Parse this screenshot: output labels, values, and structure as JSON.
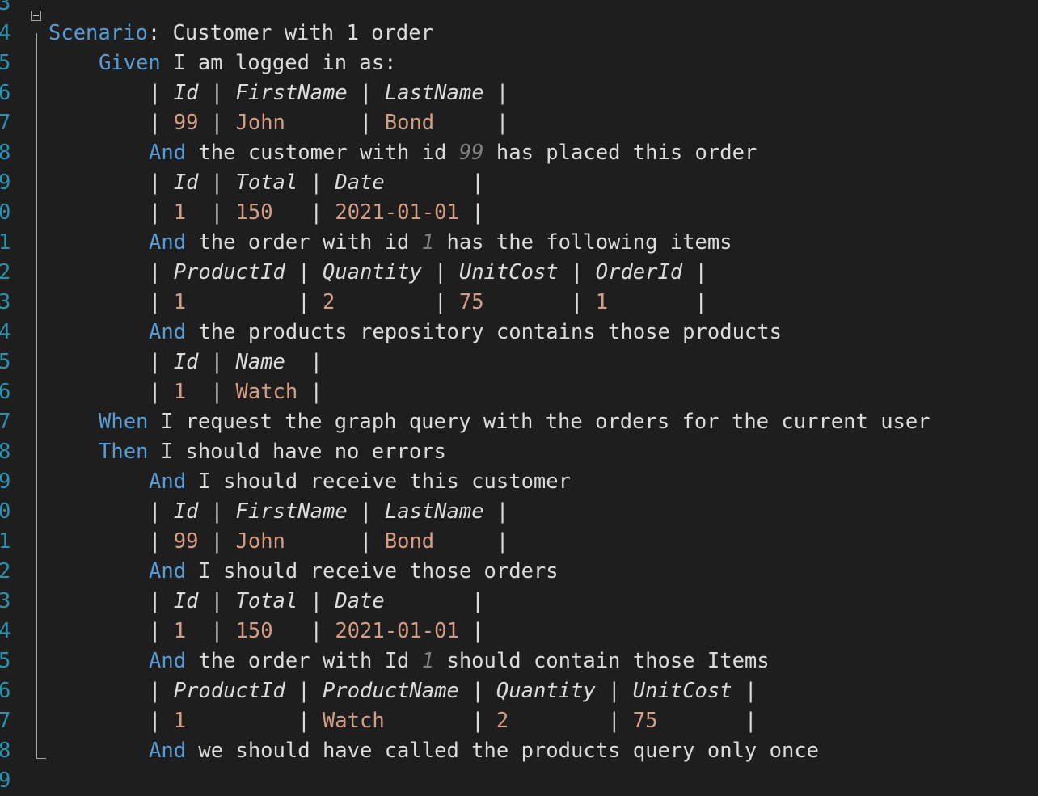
{
  "editor": {
    "lines": [
      {
        "num": "3",
        "segments": []
      },
      {
        "num": "4",
        "indent": 0,
        "segments": [
          {
            "cls": "kw",
            "t": "Scenario"
          },
          {
            "cls": "",
            "t": ": Customer with 1 order"
          }
        ]
      },
      {
        "num": "5",
        "indent": 1,
        "segments": [
          {
            "cls": "kw",
            "t": "Given"
          },
          {
            "cls": "",
            "t": " I am logged in as:"
          }
        ]
      },
      {
        "num": "6",
        "indent": 2,
        "segments": [
          {
            "cls": "",
            "t": "| "
          },
          {
            "cls": "hdr",
            "t": "Id"
          },
          {
            "cls": "",
            "t": " | "
          },
          {
            "cls": "hdr",
            "t": "FirstName"
          },
          {
            "cls": "",
            "t": " | "
          },
          {
            "cls": "hdr",
            "t": "LastName"
          },
          {
            "cls": "",
            "t": " |"
          }
        ]
      },
      {
        "num": "7",
        "indent": 2,
        "segments": [
          {
            "cls": "",
            "t": "| "
          },
          {
            "cls": "val",
            "t": "99"
          },
          {
            "cls": "",
            "t": " | "
          },
          {
            "cls": "val",
            "t": "John     "
          },
          {
            "cls": "",
            "t": " | "
          },
          {
            "cls": "val",
            "t": "Bond    "
          },
          {
            "cls": "",
            "t": " |"
          }
        ]
      },
      {
        "num": "8",
        "indent": 2,
        "segments": [
          {
            "cls": "kw",
            "t": "And"
          },
          {
            "cls": "",
            "t": " the customer with id "
          },
          {
            "cls": "ph",
            "t": "99"
          },
          {
            "cls": "",
            "t": " has placed this order"
          }
        ]
      },
      {
        "num": "9",
        "indent": 2,
        "segments": [
          {
            "cls": "",
            "t": "| "
          },
          {
            "cls": "hdr",
            "t": "Id"
          },
          {
            "cls": "",
            "t": " | "
          },
          {
            "cls": "hdr",
            "t": "Total"
          },
          {
            "cls": "",
            "t": " | "
          },
          {
            "cls": "hdr",
            "t": "Date      "
          },
          {
            "cls": "",
            "t": " |"
          }
        ]
      },
      {
        "num": "0",
        "indent": 2,
        "segments": [
          {
            "cls": "",
            "t": "| "
          },
          {
            "cls": "val",
            "t": "1 "
          },
          {
            "cls": "",
            "t": " | "
          },
          {
            "cls": "val",
            "t": "150  "
          },
          {
            "cls": "",
            "t": " | "
          },
          {
            "cls": "val",
            "t": "2021-01-01"
          },
          {
            "cls": "",
            "t": " |"
          }
        ]
      },
      {
        "num": "1",
        "indent": 2,
        "segments": [
          {
            "cls": "kw",
            "t": "And"
          },
          {
            "cls": "",
            "t": " the order with id "
          },
          {
            "cls": "ph",
            "t": "1"
          },
          {
            "cls": "",
            "t": " has the following items"
          }
        ]
      },
      {
        "num": "2",
        "indent": 2,
        "segments": [
          {
            "cls": "",
            "t": "| "
          },
          {
            "cls": "hdr",
            "t": "ProductId"
          },
          {
            "cls": "",
            "t": " | "
          },
          {
            "cls": "hdr",
            "t": "Quantity"
          },
          {
            "cls": "",
            "t": " | "
          },
          {
            "cls": "hdr",
            "t": "UnitCost"
          },
          {
            "cls": "",
            "t": " | "
          },
          {
            "cls": "hdr",
            "t": "OrderId"
          },
          {
            "cls": "",
            "t": " |"
          }
        ]
      },
      {
        "num": "3",
        "indent": 2,
        "segments": [
          {
            "cls": "",
            "t": "| "
          },
          {
            "cls": "val",
            "t": "1        "
          },
          {
            "cls": "",
            "t": " | "
          },
          {
            "cls": "val",
            "t": "2       "
          },
          {
            "cls": "",
            "t": " | "
          },
          {
            "cls": "val",
            "t": "75      "
          },
          {
            "cls": "",
            "t": " | "
          },
          {
            "cls": "val",
            "t": "1      "
          },
          {
            "cls": "",
            "t": " |"
          }
        ]
      },
      {
        "num": "4",
        "indent": 2,
        "segments": [
          {
            "cls": "kw",
            "t": "And"
          },
          {
            "cls": "",
            "t": " the products repository contains those products"
          }
        ]
      },
      {
        "num": "5",
        "indent": 2,
        "segments": [
          {
            "cls": "",
            "t": "| "
          },
          {
            "cls": "hdr",
            "t": "Id"
          },
          {
            "cls": "",
            "t": " | "
          },
          {
            "cls": "hdr",
            "t": "Name "
          },
          {
            "cls": "",
            "t": " |"
          }
        ]
      },
      {
        "num": "6",
        "indent": 2,
        "segments": [
          {
            "cls": "",
            "t": "| "
          },
          {
            "cls": "val",
            "t": "1 "
          },
          {
            "cls": "",
            "t": " | "
          },
          {
            "cls": "val",
            "t": "Watch"
          },
          {
            "cls": "",
            "t": " |"
          }
        ]
      },
      {
        "num": "7",
        "indent": 1,
        "segments": [
          {
            "cls": "kw",
            "t": "When"
          },
          {
            "cls": "",
            "t": " I request the graph query with the orders for the current user"
          }
        ]
      },
      {
        "num": "8",
        "indent": 1,
        "segments": [
          {
            "cls": "kw",
            "t": "Then"
          },
          {
            "cls": "",
            "t": " I should have no errors"
          }
        ]
      },
      {
        "num": "9",
        "indent": 2,
        "segments": [
          {
            "cls": "kw",
            "t": "And"
          },
          {
            "cls": "",
            "t": " I should receive this customer"
          }
        ]
      },
      {
        "num": "0",
        "indent": 2,
        "segments": [
          {
            "cls": "",
            "t": "| "
          },
          {
            "cls": "hdr",
            "t": "Id"
          },
          {
            "cls": "",
            "t": " | "
          },
          {
            "cls": "hdr",
            "t": "FirstName"
          },
          {
            "cls": "",
            "t": " | "
          },
          {
            "cls": "hdr",
            "t": "LastName"
          },
          {
            "cls": "",
            "t": " |"
          }
        ]
      },
      {
        "num": "1",
        "indent": 2,
        "segments": [
          {
            "cls": "",
            "t": "| "
          },
          {
            "cls": "val",
            "t": "99"
          },
          {
            "cls": "",
            "t": " | "
          },
          {
            "cls": "val",
            "t": "John     "
          },
          {
            "cls": "",
            "t": " | "
          },
          {
            "cls": "val",
            "t": "Bond    "
          },
          {
            "cls": "",
            "t": " |"
          }
        ]
      },
      {
        "num": "2",
        "indent": 2,
        "segments": [
          {
            "cls": "kw",
            "t": "And"
          },
          {
            "cls": "",
            "t": " I should receive those orders"
          }
        ]
      },
      {
        "num": "3",
        "indent": 2,
        "segments": [
          {
            "cls": "",
            "t": "| "
          },
          {
            "cls": "hdr",
            "t": "Id"
          },
          {
            "cls": "",
            "t": " | "
          },
          {
            "cls": "hdr",
            "t": "Total"
          },
          {
            "cls": "",
            "t": " | "
          },
          {
            "cls": "hdr",
            "t": "Date      "
          },
          {
            "cls": "",
            "t": " |"
          }
        ]
      },
      {
        "num": "4",
        "indent": 2,
        "segments": [
          {
            "cls": "",
            "t": "| "
          },
          {
            "cls": "val",
            "t": "1 "
          },
          {
            "cls": "",
            "t": " | "
          },
          {
            "cls": "val",
            "t": "150  "
          },
          {
            "cls": "",
            "t": " | "
          },
          {
            "cls": "val",
            "t": "2021-01-01"
          },
          {
            "cls": "",
            "t": " |"
          }
        ]
      },
      {
        "num": "5",
        "indent": 2,
        "segments": [
          {
            "cls": "kw",
            "t": "And"
          },
          {
            "cls": "",
            "t": " the order with Id "
          },
          {
            "cls": "ph",
            "t": "1"
          },
          {
            "cls": "",
            "t": " should contain those Items"
          }
        ]
      },
      {
        "num": "6",
        "indent": 2,
        "segments": [
          {
            "cls": "",
            "t": "| "
          },
          {
            "cls": "hdr",
            "t": "ProductId"
          },
          {
            "cls": "",
            "t": " | "
          },
          {
            "cls": "hdr",
            "t": "ProductName"
          },
          {
            "cls": "",
            "t": " | "
          },
          {
            "cls": "hdr",
            "t": "Quantity"
          },
          {
            "cls": "",
            "t": " | "
          },
          {
            "cls": "hdr",
            "t": "UnitCost"
          },
          {
            "cls": "",
            "t": " |"
          }
        ]
      },
      {
        "num": "7",
        "indent": 2,
        "segments": [
          {
            "cls": "",
            "t": "| "
          },
          {
            "cls": "val",
            "t": "1        "
          },
          {
            "cls": "",
            "t": " | "
          },
          {
            "cls": "val",
            "t": "Watch      "
          },
          {
            "cls": "",
            "t": " | "
          },
          {
            "cls": "val",
            "t": "2       "
          },
          {
            "cls": "",
            "t": " | "
          },
          {
            "cls": "val",
            "t": "75      "
          },
          {
            "cls": "",
            "t": " |"
          }
        ]
      },
      {
        "num": "8",
        "indent": 2,
        "segments": [
          {
            "cls": "kw",
            "t": "And"
          },
          {
            "cls": "",
            "t": " we should have called the products query only once"
          }
        ]
      },
      {
        "num": "9",
        "segments": []
      }
    ]
  }
}
